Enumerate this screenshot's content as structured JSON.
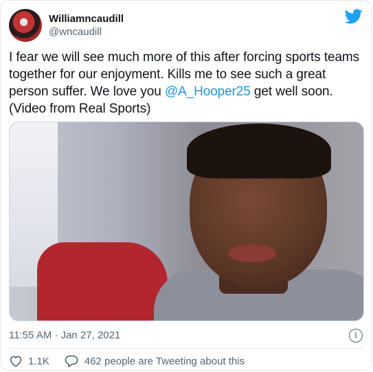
{
  "tweet": {
    "display_name": "Williamncaudill",
    "handle": "@wncaudill",
    "text_before_mention": "I fear we will see much more of this after forcing sports teams together for our enjoyment. Kills me to see such a great person suffer.  We love you ",
    "mention": "@A_Hooper25",
    "text_after_mention": " get well soon. (Video from Real Sports)",
    "timestamp": "11:55 AM · Jan 27, 2021",
    "info_symbol": "i",
    "likes": "1.1K",
    "replies_text": "462 people are Tweeting about this"
  },
  "icons": {
    "brand": "twitter-bird-icon",
    "like": "heart-icon",
    "reply": "speech-bubble-icon",
    "info": "info-icon"
  },
  "colors": {
    "brand": "#1da1f2",
    "mention": "#1b95e0",
    "secondary_text": "#536471",
    "primary_text": "#0f1419"
  }
}
